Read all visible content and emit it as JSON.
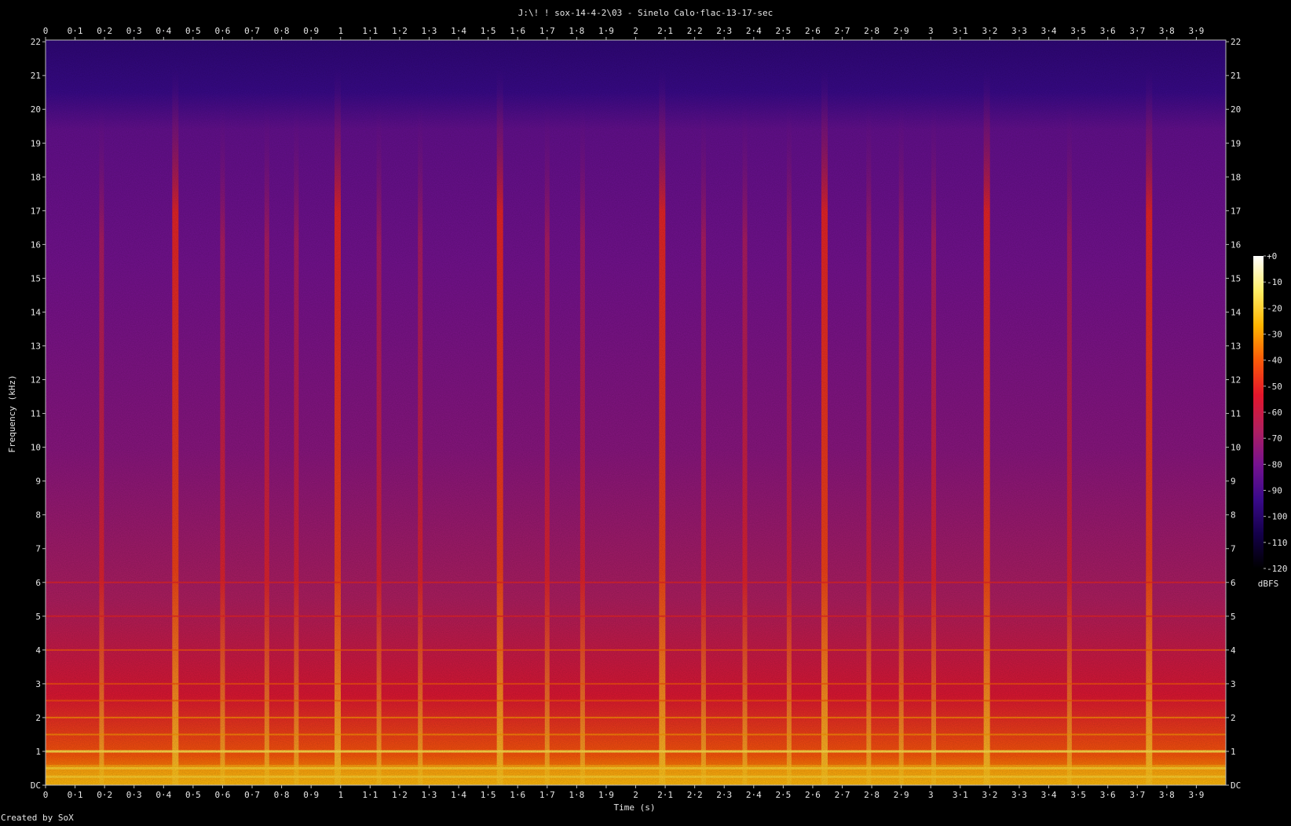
{
  "chart_data": {
    "type": "heatmap",
    "title": "J:\\! ! sox-14-4-2\\03 - Sinelo Calo·flac-13-17-sec",
    "xlabel": "Time (s)",
    "ylabel": "Frequency (kHz)",
    "x_ticks": [
      "0",
      "0·1",
      "0·2",
      "0·3",
      "0·4",
      "0·5",
      "0·6",
      "0·7",
      "0·8",
      "0·9",
      "1",
      "1·1",
      "1·2",
      "1·3",
      "1·4",
      "1·5",
      "1·6",
      "1·7",
      "1·8",
      "1·9",
      "2",
      "2·1",
      "2·2",
      "2·3",
      "2·4",
      "2·5",
      "2·6",
      "2·7",
      "2·8",
      "2·9",
      "3",
      "3·1",
      "3·2",
      "3·3",
      "3·4",
      "3·5",
      "3·6",
      "3·7",
      "3·8",
      "3·9"
    ],
    "x_tick_values": [
      0,
      0.1,
      0.2,
      0.3,
      0.4,
      0.5,
      0.6,
      0.7,
      0.8,
      0.9,
      1.0,
      1.1,
      1.2,
      1.3,
      1.4,
      1.5,
      1.6,
      1.7,
      1.8,
      1.9,
      2.0,
      2.1,
      2.2,
      2.3,
      2.4,
      2.5,
      2.6,
      2.7,
      2.8,
      2.9,
      3.0,
      3.1,
      3.2,
      3.3,
      3.4,
      3.5,
      3.6,
      3.7,
      3.8,
      3.9
    ],
    "xlim": [
      0,
      4.0
    ],
    "y_ticks": [
      "DC",
      "1",
      "2",
      "3",
      "4",
      "5",
      "6",
      "7",
      "8",
      "9",
      "10",
      "11",
      "12",
      "13",
      "14",
      "15",
      "16",
      "17",
      "18",
      "19",
      "20",
      "21",
      "22"
    ],
    "y_tick_values": [
      0,
      1,
      2,
      3,
      4,
      5,
      6,
      7,
      8,
      9,
      10,
      11,
      12,
      13,
      14,
      15,
      16,
      17,
      18,
      19,
      20,
      21,
      22
    ],
    "ylim": [
      0,
      22.05
    ],
    "colorbar": {
      "label": "dBFS",
      "ticks": [
        "+0",
        "-10",
        "-20",
        "-30",
        "-40",
        "-50",
        "-60",
        "-70",
        "-80",
        "-90",
        "-100",
        "-110",
        "-120"
      ],
      "tick_values": [
        0,
        -10,
        -20,
        -30,
        -40,
        -50,
        -60,
        -70,
        -80,
        -90,
        -100,
        -110,
        -120
      ],
      "range": [
        -120,
        0
      ],
      "colors": [
        "#000000",
        "#14004a",
        "#3a0a8a",
        "#76128f",
        "#b01f5e",
        "#e4162b",
        "#fa5a08",
        "#ffb400",
        "#ffee66",
        "#ffffff"
      ]
    },
    "onsets_s": [
      0.19,
      0.44,
      0.6,
      0.75,
      0.85,
      0.99,
      1.13,
      1.27,
      1.54,
      1.7,
      1.82,
      2.09,
      2.23,
      2.37,
      2.52,
      2.64,
      2.79,
      2.9,
      3.01,
      3.19,
      3.47,
      3.74
    ],
    "strong_onsets_s": [
      0.44,
      0.99,
      1.54,
      2.09,
      2.64,
      3.19,
      3.74
    ],
    "harmonic_lines_khz": [
      0.25,
      0.5,
      1.0,
      1.5,
      2.0,
      2.5,
      3.0,
      4.0,
      5.0,
      6.0
    ],
    "footer": "Created by SoX"
  }
}
